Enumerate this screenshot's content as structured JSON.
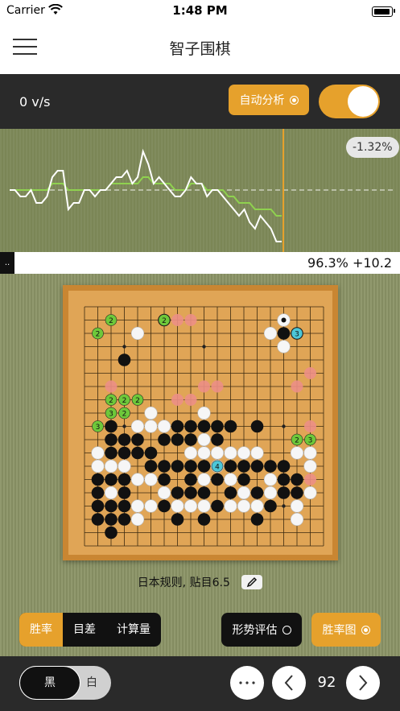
{
  "status": {
    "carrier": "Carrier",
    "time": "1:48 PM"
  },
  "nav": {
    "title": "智子围棋",
    "menu_icon": "hamburger-menu-icon"
  },
  "toolbar": {
    "speed": "0 v/s",
    "auto_label": "自动分析",
    "auto_on": true,
    "toggle_on": true
  },
  "graph": {
    "badge": "-1.32%",
    "white_line": [
      0,
      0,
      -1,
      -1,
      0,
      -2,
      -2,
      -1,
      2,
      3,
      3,
      -3,
      -2,
      -2,
      0,
      0,
      -1,
      0,
      0,
      1,
      2,
      2,
      3,
      1,
      2,
      6,
      4,
      1,
      2,
      1,
      0,
      -1,
      -1,
      0,
      2,
      1,
      1,
      -1,
      0,
      0,
      -1,
      -2,
      -3,
      -4,
      -3,
      -5,
      -6,
      -4,
      -5,
      -6,
      -8,
      -8
    ],
    "green_line": [
      0,
      0,
      0,
      0,
      0,
      0,
      0,
      0,
      1,
      1,
      1,
      0,
      0,
      0,
      0,
      0,
      0,
      0,
      0,
      1,
      1,
      1,
      1,
      1,
      1,
      2,
      2,
      1,
      1,
      1,
      1,
      0,
      0,
      0,
      1,
      1,
      1,
      0,
      0,
      0,
      0,
      -1,
      -1,
      -2,
      -2,
      -2,
      -3,
      -3,
      -3,
      -3,
      -4,
      -4
    ]
  },
  "info": {
    "left_mark": "..",
    "winrate": "96.3% +10.2"
  },
  "board": {
    "size": 19,
    "black": [
      [
        3,
        4
      ],
      [
        6,
        1
      ],
      [
        2,
        9
      ],
      [
        2,
        10
      ],
      [
        2,
        11
      ],
      [
        3,
        10
      ],
      [
        3,
        11
      ],
      [
        4,
        10
      ],
      [
        5,
        11
      ],
      [
        6,
        10
      ],
      [
        7,
        9
      ],
      [
        7,
        10
      ],
      [
        8,
        9
      ],
      [
        8,
        10
      ],
      [
        9,
        9
      ],
      [
        10,
        9
      ],
      [
        10,
        10
      ],
      [
        11,
        9
      ],
      [
        13,
        9
      ],
      [
        4,
        11
      ],
      [
        5,
        12
      ],
      [
        6,
        12
      ],
      [
        7,
        12
      ],
      [
        8,
        12
      ],
      [
        9,
        12
      ],
      [
        11,
        12
      ],
      [
        12,
        12
      ],
      [
        13,
        12
      ],
      [
        14,
        12
      ],
      [
        15,
        12
      ],
      [
        1,
        13
      ],
      [
        2,
        13
      ],
      [
        3,
        13
      ],
      [
        6,
        13
      ],
      [
        8,
        13
      ],
      [
        10,
        13
      ],
      [
        12,
        13
      ],
      [
        16,
        13
      ],
      [
        16,
        14
      ],
      [
        1,
        14
      ],
      [
        3,
        14
      ],
      [
        7,
        14
      ],
      [
        8,
        14
      ],
      [
        9,
        14
      ],
      [
        11,
        14
      ],
      [
        13,
        14
      ],
      [
        15,
        14
      ],
      [
        1,
        15
      ],
      [
        2,
        15
      ],
      [
        3,
        15
      ],
      [
        6,
        15
      ],
      [
        10,
        15
      ],
      [
        14,
        15
      ],
      [
        2,
        16
      ],
      [
        1,
        16
      ],
      [
        2,
        16
      ],
      [
        3,
        16
      ],
      [
        7,
        16
      ],
      [
        9,
        16
      ],
      [
        13,
        16
      ],
      [
        2,
        17
      ],
      [
        15,
        2
      ],
      [
        15,
        13
      ],
      [
        16,
        2
      ]
    ],
    "white": [
      [
        15,
        1
      ],
      [
        4,
        2
      ],
      [
        14,
        2
      ],
      [
        15,
        3
      ],
      [
        5,
        8
      ],
      [
        9,
        8
      ],
      [
        5,
        9
      ],
      [
        6,
        9
      ],
      [
        4,
        9
      ],
      [
        1,
        11
      ],
      [
        2,
        11
      ],
      [
        3,
        12
      ],
      [
        8,
        11
      ],
      [
        9,
        11
      ],
      [
        9,
        10
      ],
      [
        10,
        11
      ],
      [
        10,
        12
      ],
      [
        11,
        11
      ],
      [
        12,
        11
      ],
      [
        13,
        11
      ],
      [
        16,
        11
      ],
      [
        17,
        11
      ],
      [
        17,
        12
      ],
      [
        1,
        12
      ],
      [
        2,
        12
      ],
      [
        3,
        12
      ],
      [
        2,
        14
      ],
      [
        4,
        13
      ],
      [
        5,
        13
      ],
      [
        6,
        14
      ],
      [
        9,
        13
      ],
      [
        11,
        13
      ],
      [
        12,
        13
      ],
      [
        14,
        13
      ],
      [
        12,
        14
      ],
      [
        14,
        14
      ],
      [
        17,
        14
      ],
      [
        2,
        15
      ],
      [
        4,
        15
      ],
      [
        7,
        15
      ],
      [
        8,
        15
      ],
      [
        9,
        15
      ],
      [
        11,
        15
      ],
      [
        12,
        15
      ],
      [
        13,
        15
      ],
      [
        16,
        15
      ],
      [
        16,
        16
      ],
      [
        4,
        16
      ],
      [
        1,
        14
      ],
      [
        5,
        15
      ]
    ],
    "markers": [
      {
        "x": 2,
        "y": 1,
        "n": "2",
        "c": "#6ec83a"
      },
      {
        "x": 6,
        "y": 1,
        "n": "2",
        "c": "#6ec83a"
      },
      {
        "x": 1,
        "y": 2,
        "n": "2",
        "c": "#6ec83a"
      },
      {
        "x": 2,
        "y": 7,
        "n": "2",
        "c": "#6ec83a"
      },
      {
        "x": 3,
        "y": 7,
        "n": "2",
        "c": "#6ec83a"
      },
      {
        "x": 4,
        "y": 7,
        "n": "2",
        "c": "#6ec83a"
      },
      {
        "x": 2,
        "y": 8,
        "n": "3",
        "c": "#6ec83a"
      },
      {
        "x": 3,
        "y": 8,
        "n": "2",
        "c": "#6ec83a"
      },
      {
        "x": 1,
        "y": 9,
        "n": "3",
        "c": "#6ec83a"
      },
      {
        "x": 16,
        "y": 10,
        "n": "2",
        "c": "#6ec83a"
      },
      {
        "x": 17,
        "y": 10,
        "n": "3",
        "c": "#6ec83a"
      },
      {
        "x": 16,
        "y": 2,
        "n": "3",
        "c": "#4cc7d8"
      },
      {
        "x": 10,
        "y": 12,
        "n": "4",
        "c": "#4cc7d8"
      }
    ],
    "pink": [
      [
        7,
        1
      ],
      [
        8,
        1
      ],
      [
        17,
        5
      ],
      [
        2,
        6
      ],
      [
        9,
        6
      ],
      [
        10,
        6
      ],
      [
        16,
        6
      ],
      [
        7,
        7
      ],
      [
        8,
        7
      ],
      [
        17,
        9
      ],
      [
        17,
        13
      ]
    ],
    "last_move": [
      15,
      1
    ],
    "rule_text": "日本规则, 贴目6.5"
  },
  "controls": {
    "seg": [
      "胜率",
      "目差",
      "计算量"
    ],
    "seg_active": 0,
    "situation": "形势评估",
    "winrate_chart": "胜率图"
  },
  "bottom": {
    "black": "黑",
    "white": "白",
    "move": "92"
  },
  "colors": {
    "accent": "#e6a12c",
    "dark": "#2a2a2a"
  }
}
